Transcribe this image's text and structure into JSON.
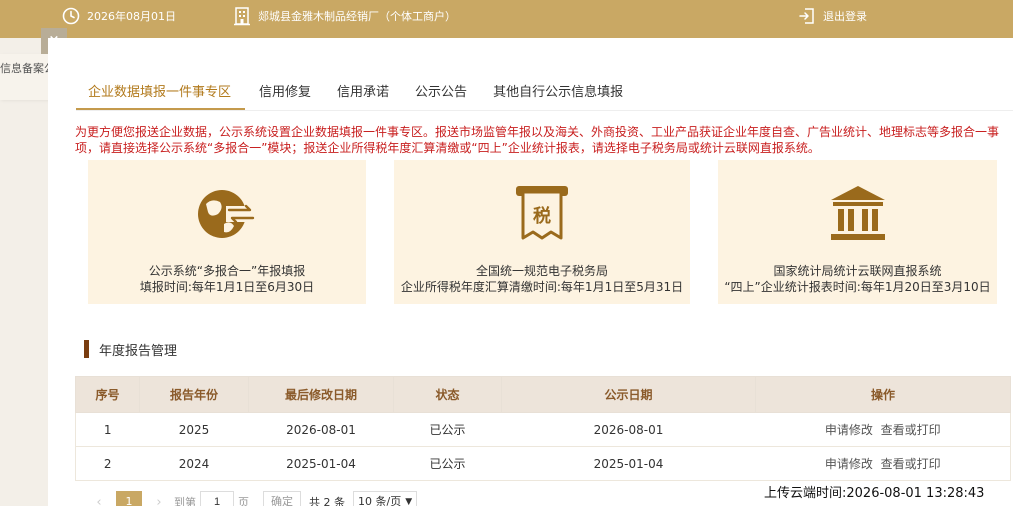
{
  "topbar": {
    "date": "2026年08月01日",
    "company": "郯城县金雅木制品经销厂（个体工商户）",
    "logout": "退出登录"
  },
  "notice": {
    "text": "信息备案公告",
    "close": "×"
  },
  "tabs": [
    {
      "label": "企业数据填报一件事专区",
      "active": true
    },
    {
      "label": "信用修复"
    },
    {
      "label": "信用承诺"
    },
    {
      "label": "公示公告"
    },
    {
      "label": "其他自行公示信息填报"
    }
  ],
  "intro": "为更方便您报送企业数据，公示系统设置企业数据填报一件事专区。报送市场监管年报以及海关、外商投资、工业产品获证企业年度自查、广告业统计、地理标志等多报合一事项，请直接选择公示系统“多报合一”模块；报送企业所得税年度汇算清缴或“四上”企业统计报表，请选择电子税务局或统计云联网直报系统。",
  "cards": [
    {
      "line1": "公示系统“多报合一”年报填报",
      "line2": "填报时间:每年1月1日至6月30日",
      "icon": "globe-exchange-icon"
    },
    {
      "line1": "全国统一规范电子税务局",
      "line2": "企业所得税年度汇算清缴时间:每年1月1日至5月31日",
      "icon": "tax-icon",
      "icon_text": "税"
    },
    {
      "line1": "国家统计局统计云联网直报系统",
      "line2": "“四上”企业统计报表时间:每年1月20日至3月10日",
      "icon": "government-building-icon"
    }
  ],
  "section": {
    "title": "年度报告管理"
  },
  "table": {
    "headers": [
      "序号",
      "报告年份",
      "最后修改日期",
      "状态",
      "公示日期",
      "操作"
    ],
    "rows": [
      {
        "no": "1",
        "year": "2025",
        "modified": "2026-08-01",
        "status": "已公示",
        "published": "2026-08-01",
        "op1": "申请修改",
        "op2": "查看或打印"
      },
      {
        "no": "2",
        "year": "2024",
        "modified": "2025-01-04",
        "status": "已公示",
        "published": "2025-01-04",
        "op1": "申请修改",
        "op2": "查看或打印"
      }
    ]
  },
  "pager": {
    "prev": "‹",
    "page": "1",
    "next": "›",
    "goto_label": "到第",
    "goto_value": "1",
    "page_unit": "页",
    "confirm": "确定",
    "total": "共 2 条",
    "page_size": "10 条/页"
  },
  "upload_time": "上传云端时间:2026-08-01 13:28:43",
  "colors": {
    "brand": "#c9a864",
    "card_bg": "#fdf3e1",
    "intro_red": "#c81e1e",
    "icon_brown": "#9a6a1c"
  }
}
